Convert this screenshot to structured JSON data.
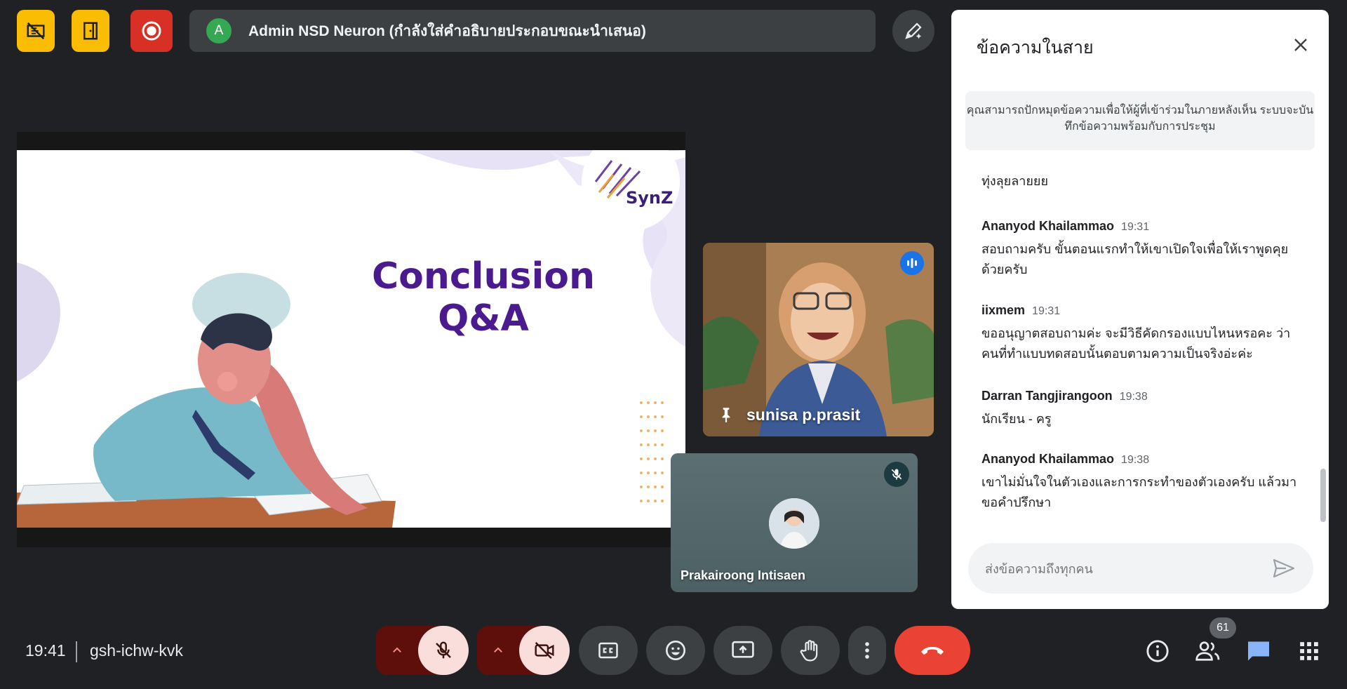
{
  "top_bar": {
    "presenter_initial": "A",
    "presenter_text": "Admin NSD Neuron (กำลังใส่คำอธิบายประกอบขณะนำเสนอ)"
  },
  "slide": {
    "title_line1": "Conclusion",
    "title_line2": "Q&A",
    "brand": "SynZ"
  },
  "tiles": {
    "pinned_name": "sunisa p.prasit",
    "second_name": "Prakairoong Intisaen"
  },
  "chat": {
    "title": "ข้อความในสาย",
    "notice": "คุณสามารถปักหมุดข้อความเพื่อให้ผู้ที่เข้าร่วมในภายหลังเห็น ระบบจะบันทึกข้อความพร้อมกับการประชุม",
    "messages": [
      {
        "name": "",
        "time": "",
        "text": "ทุ่งลุยลายยย"
      },
      {
        "name": "Ananyod Khailammao",
        "time": "19:31",
        "text": "สอบถามครับ ขั้นตอนแรกทำให้เขาเปิดใจเพื่อให้เราพูดคุยด้วยครับ"
      },
      {
        "name": "iixmem",
        "time": "19:31",
        "text": "ขออนุญาตสอบถามค่ะ จะมีวิธีคัดกรองแบบไหนหรอคะ ว่าคนที่ทำแบบทดสอบนั้นตอบตามความเป็นจริงอ่ะค่ะ"
      },
      {
        "name": "Darran Tangjirangoon",
        "time": "19:38",
        "text": "นักเรียน - ครู"
      },
      {
        "name": "Ananyod Khailammao",
        "time": "19:38",
        "text": "เขาไม่มั่นใจในตัวเองและการกระทำของตัวเองครับ แล้วมาขอคำปรึกษา"
      }
    ],
    "input_placeholder": "ส่งข้อความถึงทุกคน"
  },
  "bottom_bar": {
    "time": "19:41",
    "meeting_code": "gsh-ichw-kvk",
    "participants_count": "61"
  },
  "colors": {
    "background": "#202124",
    "warning_yellow": "#fbbc04",
    "record_red": "#d93025",
    "hangup_red": "#ea4335",
    "muted_pink": "#f9dedc",
    "chat_accent": "#1a73e8",
    "slide_title": "#4a1a8e"
  },
  "icons": [
    "no-annotation-icon",
    "exit-door-icon",
    "record-icon",
    "pen-sparkle-icon",
    "close-icon",
    "send-icon",
    "speaking-icon",
    "pin-icon",
    "mic-off-icon",
    "camera-off-icon",
    "captions-icon",
    "emoji-icon",
    "present-icon",
    "raise-hand-icon",
    "more-vert-icon",
    "call-end-icon",
    "info-icon",
    "people-icon",
    "chat-icon",
    "apps-grid-icon"
  ]
}
